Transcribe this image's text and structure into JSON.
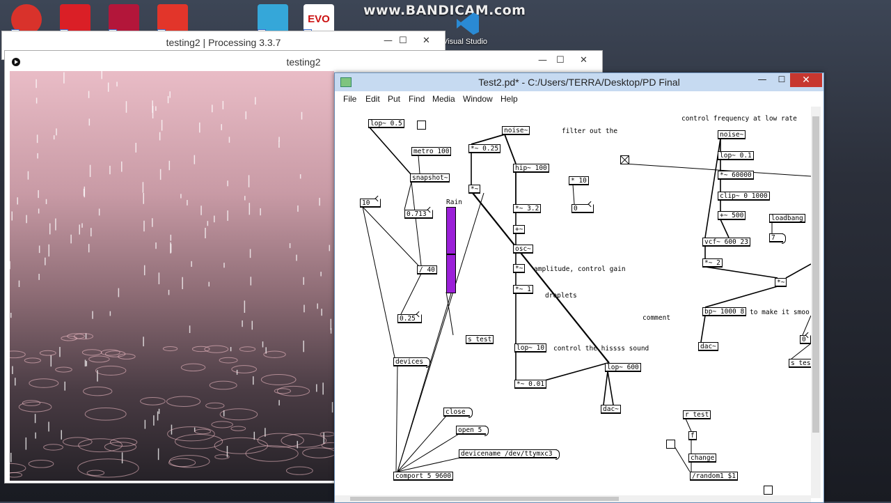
{
  "desktop": {
    "watermark": "www.BANDICAM.com",
    "vs_label": "Visual Studio",
    "icons": [
      "app-icon-red",
      "adobe-cloud-icon",
      "mendeley-icon",
      "pdf-icon",
      "games-icon",
      "evo-icon"
    ],
    "evo_text": "EVO"
  },
  "processing": {
    "window_title": "testing2 | Processing 3.3.7",
    "sketch_title": "testing2",
    "controls": {
      "min": "—",
      "max": "☐",
      "close": "✕"
    }
  },
  "pd": {
    "window_title": "Test2.pd* - C:/Users/TERRA/Desktop/PD Final",
    "controls": {
      "min": "—",
      "max": "☐",
      "close": "✕"
    },
    "menu": [
      "File",
      "Edit",
      "Put",
      "Find",
      "Media",
      "Window",
      "Help"
    ],
    "slider_label": "Rain",
    "slider_level": 0.45,
    "objects": [
      {
        "id": "lop05",
        "text": "lop~ 0.5"
      },
      {
        "id": "metro",
        "text": "metro 100"
      },
      {
        "id": "snapshot",
        "text": "snapshot~"
      },
      {
        "id": "n0713",
        "text": "0.713"
      },
      {
        "id": "n10",
        "text": "10"
      },
      {
        "id": "div40",
        "text": "/ 40"
      },
      {
        "id": "n025",
        "text": "0.25"
      },
      {
        "id": "devices",
        "text": "devices"
      },
      {
        "id": "close",
        "text": "close"
      },
      {
        "id": "open5",
        "text": "open 5"
      },
      {
        "id": "devname",
        "text": "devicename /dev/ttymxc3"
      },
      {
        "id": "comport",
        "text": "comport 5 9600"
      },
      {
        "id": "noise1",
        "text": "noise~"
      },
      {
        "id": "mul025",
        "text": "*~ 0.25"
      },
      {
        "id": "mulx",
        "text": "*~"
      },
      {
        "id": "hip",
        "text": "hip~ 100"
      },
      {
        "id": "mul32",
        "text": "*~ 3.2"
      },
      {
        "id": "plus",
        "text": "+~"
      },
      {
        "id": "osc",
        "text": "osc~"
      },
      {
        "id": "mul2a",
        "text": "*~"
      },
      {
        "id": "mul1",
        "text": "*~ 1"
      },
      {
        "id": "stest",
        "text": "s test"
      },
      {
        "id": "lop10",
        "text": "lop~ 10"
      },
      {
        "id": "mul001",
        "text": "*~ 0.01"
      },
      {
        "id": "lop600",
        "text": "lop~ 600"
      },
      {
        "id": "dac1",
        "text": "dac~"
      },
      {
        "id": "mul10",
        "text": "* 10"
      },
      {
        "id": "n0",
        "text": "0"
      },
      {
        "id": "noise2",
        "text": "noise~"
      },
      {
        "id": "lop01",
        "text": "lop~ 0.1"
      },
      {
        "id": "mul60000",
        "text": "*~ 60000"
      },
      {
        "id": "clip",
        "text": "clip~ 0 1000"
      },
      {
        "id": "plus500",
        "text": "+~ 500"
      },
      {
        "id": "loadbang",
        "text": "loadbang"
      },
      {
        "id": "n7",
        "text": "7"
      },
      {
        "id": "vcf",
        "text": "vcf~ 600 23"
      },
      {
        "id": "mul2",
        "text": "*~ 2"
      },
      {
        "id": "mul3",
        "text": "*~"
      },
      {
        "id": "bp",
        "text": "bp~ 1000 8"
      },
      {
        "id": "dac2",
        "text": "dac~"
      },
      {
        "id": "rtest",
        "text": "r test"
      },
      {
        "id": "f",
        "text": "f"
      },
      {
        "id": "change",
        "text": "change"
      },
      {
        "id": "random",
        "text": "/random1 $1"
      },
      {
        "id": "stest2",
        "text": "s tes"
      },
      {
        "id": "n0b",
        "text": "0"
      }
    ],
    "comments": [
      {
        "id": "c1",
        "text": "filter out the"
      },
      {
        "id": "c2",
        "text": "control frequency at low rate"
      },
      {
        "id": "c3",
        "text": "amplitude, control gain"
      },
      {
        "id": "c4",
        "text": "droplets"
      },
      {
        "id": "c5",
        "text": "comment"
      },
      {
        "id": "c6",
        "text": "to make it smoo"
      },
      {
        "id": "c7",
        "text": "control the hissss sound"
      }
    ]
  }
}
